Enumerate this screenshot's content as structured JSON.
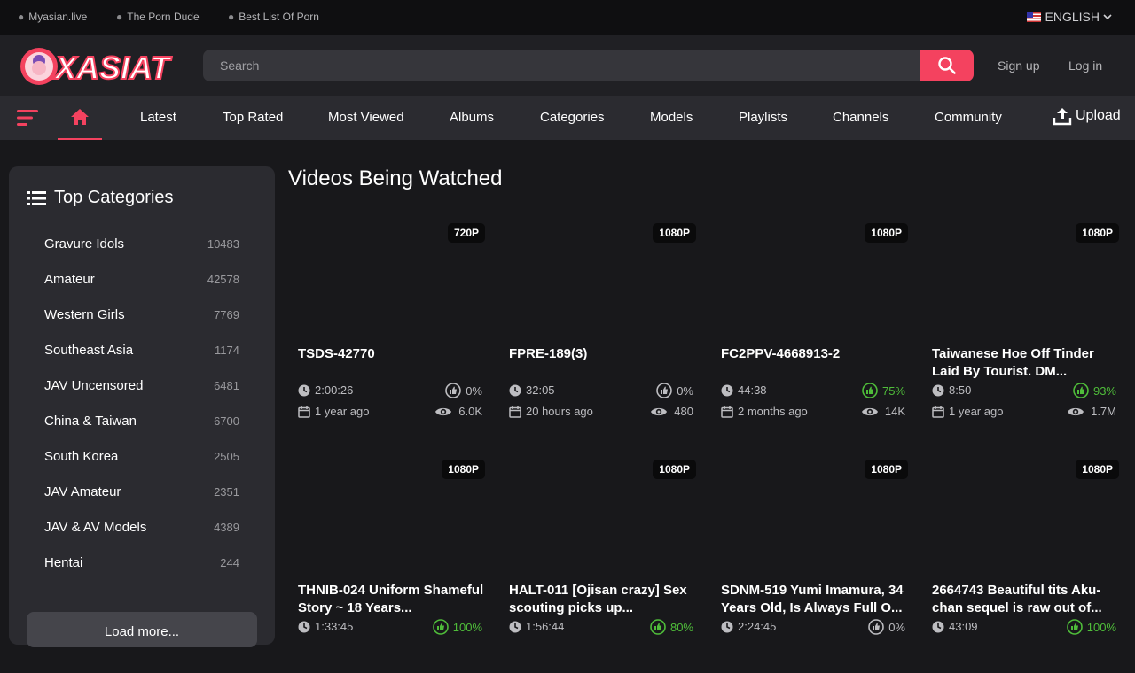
{
  "topbar": {
    "links": [
      "Myasian.live",
      "The Porn Dude",
      "Best List Of Porn"
    ],
    "language": "ENGLISH"
  },
  "header": {
    "logo_text": "XASIAT",
    "search_placeholder": "Search",
    "signup": "Sign up",
    "login": "Log in"
  },
  "nav": {
    "items": [
      "Latest",
      "Top Rated",
      "Most Viewed",
      "Albums",
      "Categories",
      "Models",
      "Playlists",
      "Channels",
      "Community"
    ],
    "upload": "Upload"
  },
  "sidebar": {
    "title": "Top Categories",
    "categories": [
      {
        "name": "Gravure Idols",
        "count": "10483"
      },
      {
        "name": "Amateur",
        "count": "42578"
      },
      {
        "name": "Western Girls",
        "count": "7769"
      },
      {
        "name": "Southeast Asia",
        "count": "1174"
      },
      {
        "name": "JAV Uncensored",
        "count": "6481"
      },
      {
        "name": "China & Taiwan",
        "count": "6700"
      },
      {
        "name": "South Korea",
        "count": "2505"
      },
      {
        "name": "JAV Amateur",
        "count": "2351"
      },
      {
        "name": "JAV & AV Models",
        "count": "4389"
      },
      {
        "name": "Hentai",
        "count": "244"
      }
    ],
    "load_more": "Load more..."
  },
  "main": {
    "title": "Videos Being Watched",
    "videos": [
      {
        "quality": "720P",
        "title": "TSDS-42770",
        "duration": "2:00:26",
        "rating": "0%",
        "age": "1 year ago",
        "views": "6.0K"
      },
      {
        "quality": "1080P",
        "title": "FPRE-189(3)",
        "duration": "32:05",
        "rating": "0%",
        "age": "20 hours ago",
        "views": "480"
      },
      {
        "quality": "1080P",
        "title": "FC2PPV-4668913-2",
        "duration": "44:38",
        "rating": "75%",
        "age": "2 months ago",
        "views": "14K"
      },
      {
        "quality": "1080P",
        "title": "Taiwanese Hoe Off Tinder Laid By Tourist. DM...",
        "duration": "8:50",
        "rating": "93%",
        "age": "1 year ago",
        "views": "1.7M"
      },
      {
        "quality": "1080P",
        "title": "THNIB-024 Uniform Shameful Story ~ 18 Years...",
        "duration": "1:33:45",
        "rating": "100%",
        "age": "",
        "views": ""
      },
      {
        "quality": "1080P",
        "title": "HALT-011 [Ojisan crazy] Sex scouting picks up...",
        "duration": "1:56:44",
        "rating": "80%",
        "age": "",
        "views": ""
      },
      {
        "quality": "1080P",
        "title": "SDNM-519 Yumi Imamura, 34 Years Old, Is Always Full O...",
        "duration": "2:24:45",
        "rating": "0%",
        "age": "",
        "views": ""
      },
      {
        "quality": "1080P",
        "title": "2664743 Beautiful tits Aku-chan sequel is raw out of...",
        "duration": "43:09",
        "rating": "100%",
        "age": "",
        "views": ""
      }
    ]
  },
  "colors": {
    "accent": "#f4425f",
    "rating_green": "#4fbd3a"
  }
}
